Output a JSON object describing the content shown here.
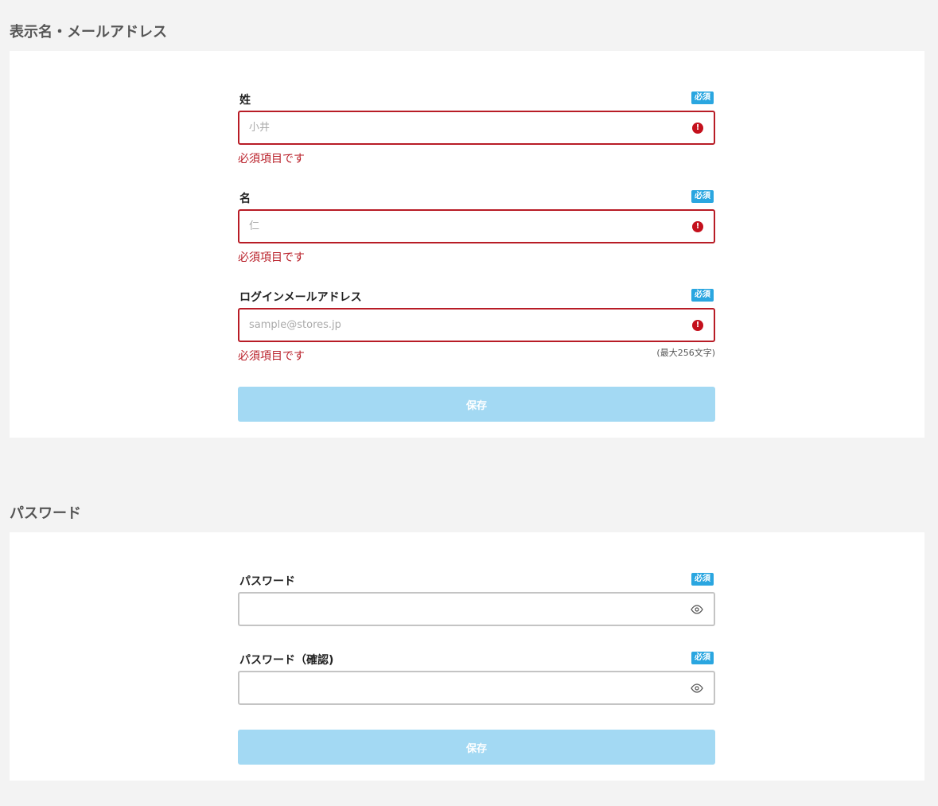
{
  "profile_section": {
    "title": "表示名・メールアドレス",
    "last_name": {
      "label": "姓",
      "badge": "必須",
      "placeholder": "小井",
      "value": "",
      "error": "必須項目です"
    },
    "first_name": {
      "label": "名",
      "badge": "必須",
      "placeholder": "仁",
      "value": "",
      "error": "必須項目です"
    },
    "email": {
      "label": "ログインメールアドレス",
      "badge": "必須",
      "placeholder": "sample@stores.jp",
      "value": "",
      "error": "必須項目です",
      "hint": "(最大256文字)"
    },
    "save_label": "保存"
  },
  "password_section": {
    "title": "パスワード",
    "password": {
      "label": "パスワード",
      "badge": "必須",
      "value": ""
    },
    "password_confirm": {
      "label": "パスワード（確認)",
      "badge": "必須",
      "value": ""
    },
    "save_label": "保存"
  },
  "colors": {
    "accent_badge": "#2aa6e0",
    "error": "#b81c26",
    "button_disabled": "#a3d9f3",
    "page_background": "#f3f3f3"
  },
  "icons": {
    "error": "error-circle-icon",
    "password_toggle": "eye-icon"
  }
}
